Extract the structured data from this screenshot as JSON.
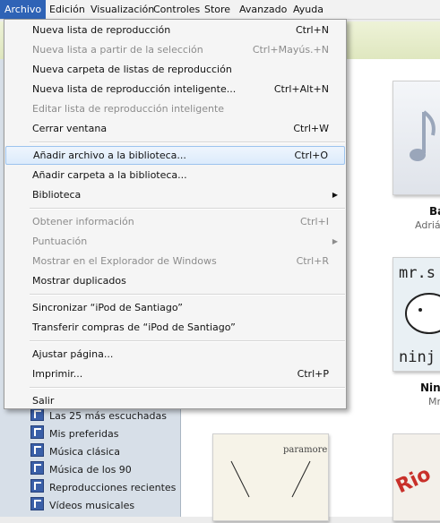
{
  "menubar": {
    "items": [
      "Archivo",
      "Edición",
      "Visualización",
      "Controles",
      "Store",
      "Avanzado",
      "Ayuda"
    ]
  },
  "file_menu": {
    "items": [
      {
        "label": "Nueva lista de reproducción",
        "shortcut": "Ctrl+N",
        "enabled": true
      },
      {
        "label": "Nueva lista a partir de la selección",
        "shortcut": "Ctrl+Mayús.+N",
        "enabled": false
      },
      {
        "label": "Nueva carpeta de listas de reproducción",
        "shortcut": "",
        "enabled": true
      },
      {
        "label": "Nueva lista de reproducción inteligente...",
        "shortcut": "Ctrl+Alt+N",
        "enabled": true
      },
      {
        "label": "Editar lista de reproducción inteligente",
        "shortcut": "",
        "enabled": false
      },
      {
        "label": "Cerrar ventana",
        "shortcut": "Ctrl+W",
        "enabled": true
      },
      {
        "label": "Añadir archivo a la biblioteca...",
        "shortcut": "Ctrl+O",
        "enabled": true,
        "highlighted": true
      },
      {
        "label": "Añadir carpeta a la biblioteca...",
        "shortcut": "",
        "enabled": true
      },
      {
        "label": "Biblioteca",
        "shortcut": "",
        "enabled": true,
        "submenu": true
      },
      {
        "label": "Obtener información",
        "shortcut": "Ctrl+I",
        "enabled": false
      },
      {
        "label": "Puntuación",
        "shortcut": "",
        "enabled": false,
        "submenu": true
      },
      {
        "label": "Mostrar en el Explorador de Windows",
        "shortcut": "Ctrl+R",
        "enabled": false
      },
      {
        "label": "Mostrar duplicados",
        "shortcut": "",
        "enabled": true
      },
      {
        "label": "Sincronizar “iPod de Santiago”",
        "shortcut": "",
        "enabled": true
      },
      {
        "label": "Transferir compras de “iPod de Santiago”",
        "shortcut": "",
        "enabled": true
      },
      {
        "label": "Ajustar página...",
        "shortcut": "",
        "enabled": true
      },
      {
        "label": "Imprimir...",
        "shortcut": "Ctrl+P",
        "enabled": true
      },
      {
        "label": "Salir",
        "shortcut": "",
        "enabled": true
      }
    ]
  },
  "sidebar": {
    "playlists": [
      "Las 25 más escuchadas",
      "Mis preferidas",
      "Música clásica",
      "Música de los 90",
      "Reproducciones recientes",
      "Vídeos musicales"
    ]
  },
  "albums": [
    {
      "title": "Ba",
      "artist": "Adriá",
      "art_text": ""
    },
    {
      "title": "Nin",
      "artist": "Mr",
      "art_text": "mr. s ninja"
    },
    {
      "title": "",
      "artist": "",
      "art_text": "paramore"
    }
  ],
  "colors": {
    "menu_active": "#2f63b6",
    "highlight_border": "#9cc3ee",
    "disabled_text": "#8c8c8c"
  }
}
